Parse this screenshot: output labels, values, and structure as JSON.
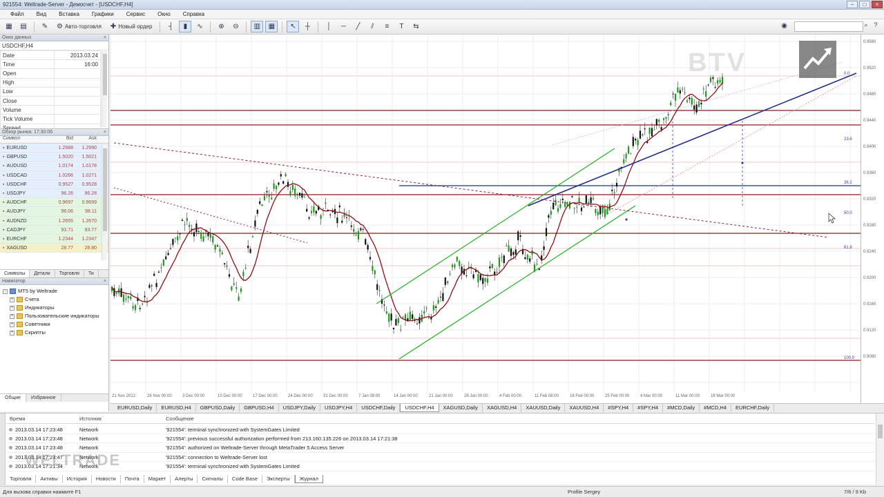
{
  "window": {
    "title": "921554: Weltrade-Server - Демосчет - [USDCHF,H4]"
  },
  "menu": [
    "Файл",
    "Вид",
    "Вставка",
    "Графики",
    "Сервис",
    "Окно",
    "Справка"
  ],
  "toolbar": {
    "auto_trading": "Авто-торговля",
    "new_order": "Новый ордер"
  },
  "data_window": {
    "title": "Окно данных",
    "symbol": "USDCHF,H4",
    "rows": [
      {
        "k": "Date",
        "v": "2013.03.24"
      },
      {
        "k": "Time",
        "v": "16:00"
      },
      {
        "k": "Open",
        "v": ""
      },
      {
        "k": "High",
        "v": ""
      },
      {
        "k": "Low",
        "v": ""
      },
      {
        "k": "Close",
        "v": ""
      },
      {
        "k": "Volume",
        "v": ""
      },
      {
        "k": "Tick Volume",
        "v": ""
      },
      {
        "k": "Spread",
        "v": ""
      }
    ]
  },
  "market_watch": {
    "title": "Обзор рынка: 17:30:06",
    "headers": [
      "Символ",
      "Bid",
      "Ask"
    ],
    "rows": [
      {
        "sym": "EURUSD",
        "bid": "1.2988",
        "ask": "1.2990",
        "bg": "blue"
      },
      {
        "sym": "GBPUSD",
        "bid": "1.5020",
        "ask": "1.5021",
        "bg": "blue"
      },
      {
        "sym": "AUDUSD",
        "bid": "1.0174",
        "ask": "1.0178",
        "bg": "blue"
      },
      {
        "sym": "USDCAD",
        "bid": "1.0266",
        "ask": "1.0271",
        "bg": "blue"
      },
      {
        "sym": "USDCHF",
        "bid": "0.9527",
        "ask": "0.9528",
        "bg": "blue"
      },
      {
        "sym": "USDJPY",
        "bid": "96.26",
        "ask": "96.28",
        "bg": "blue"
      },
      {
        "sym": "AUDCHF",
        "bid": "0.9697",
        "ask": "0.9699",
        "bg": "green"
      },
      {
        "sym": "AUDJPY",
        "bid": "98.06",
        "ask": "98.11",
        "bg": "green"
      },
      {
        "sym": "AUDNZD",
        "bid": "1.2655",
        "ask": "1.2670",
        "bg": "green"
      },
      {
        "sym": "CADJPY",
        "bid": "93.71",
        "ask": "93.77",
        "bg": "green"
      },
      {
        "sym": "EURCHF",
        "bid": "1.2344",
        "ask": "1.2347",
        "bg": "green"
      },
      {
        "sym": "XAGUSD",
        "bid": "28.77",
        "ask": "28.80",
        "bg": "yellow"
      }
    ],
    "tabs": [
      "Символы",
      "Детали",
      "Торговля",
      "Ти"
    ]
  },
  "navigator": {
    "title": "Навигатор",
    "root": "MT5 by Weltrade",
    "items": [
      "Счета",
      "Индикаторы",
      "Пользовательские индикаторы",
      "Советники",
      "Скрипты"
    ],
    "tabs": [
      "Общие",
      "Избранное"
    ]
  },
  "chart": {
    "x_labels": [
      "21 Nov 2012",
      "26 Nov 00:00",
      "3 Dec 00:00",
      "10 Dec 00:00",
      "17 Dec 00:00",
      "24 Dec 00:00",
      "31 Dec 00:00",
      "7 Jan 08:00",
      "14 Jan 00:00",
      "21 Jan 00:00",
      "28 Jan 00:00",
      "4 Feb 00:00",
      "11 Feb 08:00",
      "18 Feb 00:00",
      "25 Feb 00:00",
      "4 Mar 00:00",
      "11 Mar 00:00",
      "18 Mar 00:00"
    ],
    "fib_labels": [
      "100.0",
      "61.8",
      "50.0",
      "38.2",
      "23.6",
      "0.0"
    ],
    "price_labels": [
      "0.9560",
      "0.9520",
      "0.9480",
      "0.9440",
      "0.9400",
      "0.9360",
      "0.9320",
      "0.9280",
      "0.9240",
      "0.9200",
      "0.9160",
      "0.9120",
      "0.9080"
    ]
  },
  "chart_tabs": [
    "EURUSD,Daily",
    "EURUSD,H4",
    "GBPUSD,Daily",
    "GBPUSD,H4",
    "USDJPY,Daily",
    "USDJPY,H4",
    "USDCHF,Daily",
    "USDCHF,H4",
    "XAGUSD,Daily",
    "XAGUSD,H4",
    "XAUUSD,Daily",
    "XAUUSD,H4",
    "#SPY,H4",
    "#SPY,H4",
    "#MCD,Daily",
    "#MCD,H4",
    "EURCHF,Daily"
  ],
  "journal": {
    "headers": [
      "Время",
      "Источник",
      "Сообщение"
    ],
    "rows": [
      {
        "t": "2013.03.14 17:23:48",
        "s": "Network",
        "m": "'921554': terminal synchronized with SystemGates Limited"
      },
      {
        "t": "2013.03.14 17:23:48",
        "s": "Network",
        "m": "'921554': previous successful authorization performed from 213.160.135.226 on 2013.03.14 17:21:38"
      },
      {
        "t": "2013.03.14 17:23:48",
        "s": "Network",
        "m": "'921554': authorized on Weltrade-Server through MetaTrader 5 Access Server"
      },
      {
        "t": "2013.03.14 17:23:47",
        "s": "Network",
        "m": "'921554': connection to Weltrade-Server lost"
      },
      {
        "t": "2013.03.14 17:21:34",
        "s": "Network",
        "m": "'921554': terminal synchronized with SystemGates Limited"
      }
    ],
    "tabs": [
      "Торговля",
      "Активы",
      "История",
      "Новости",
      "Почта",
      "Маркет",
      "Алерты",
      "Сигналы",
      "Code Base",
      "Эксперты",
      "Журнал"
    ]
  },
  "statusbar": {
    "help": "Для вызова справки нажмите F1",
    "profile": "Profile Sergey",
    "traffic": "7/6 / 9 Kb"
  },
  "watermarks": {
    "weltrade": "WELTRADE",
    "btv": "BTV"
  }
}
